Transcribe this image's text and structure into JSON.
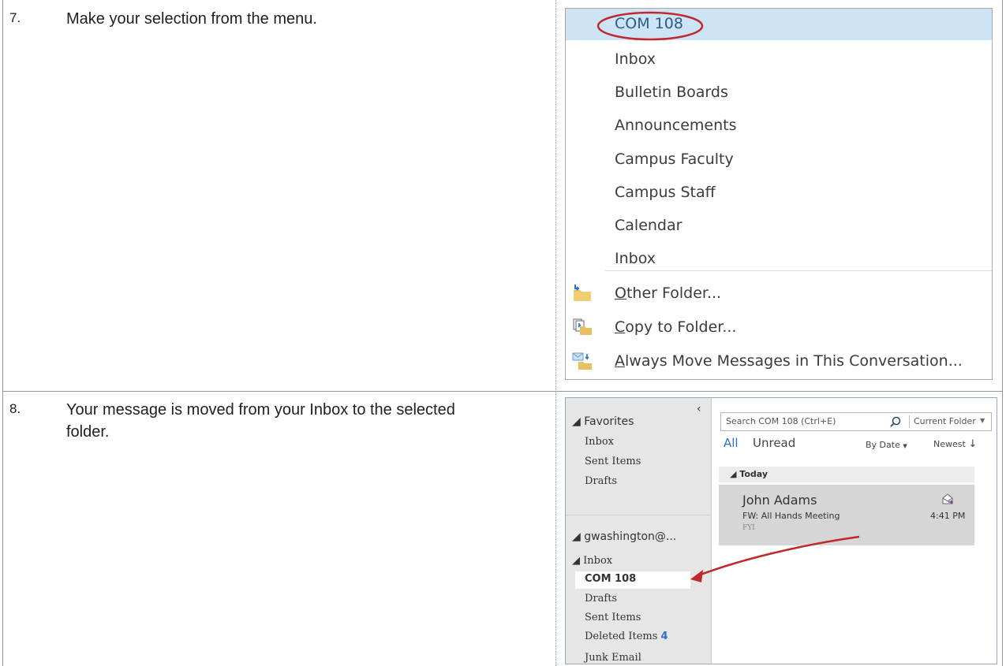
{
  "steps": [
    {
      "number": "7.",
      "text": "Make your selection from the menu."
    },
    {
      "number": "8.",
      "text": "Your message is moved from your Inbox to the selected folder."
    }
  ],
  "menu": {
    "items": [
      {
        "label": "COM 108",
        "selected": true
      },
      {
        "label": "Inbox"
      },
      {
        "label": "Bulletin Boards"
      },
      {
        "label": "Announcements"
      },
      {
        "label": "Campus Faculty"
      },
      {
        "label": "Campus Staff"
      },
      {
        "label": "Calendar"
      },
      {
        "label": "Inbox"
      }
    ],
    "actions": [
      {
        "accel": "O",
        "rest": "ther Folder...",
        "icon": "folder-move-icon"
      },
      {
        "accel": "C",
        "rest": "opy to Folder...",
        "icon": "folder-copy-icon"
      },
      {
        "accel": "A",
        "rest": "lways Move Messages in This Conversation...",
        "icon": "always-move-icon"
      }
    ],
    "highlight_color": "#cce4f5",
    "annotation_color": "#c0282d"
  },
  "outlook": {
    "collapse_glyph": "‹",
    "favorites": {
      "header": "◢ Favorites",
      "items": [
        "Inbox",
        "Sent Items",
        "Drafts"
      ]
    },
    "account": {
      "header": "◢ gwashington@...",
      "inbox": "◢ Inbox",
      "subfolder": "COM 108",
      "items": [
        "Drafts",
        "Sent Items"
      ],
      "deleted_label": "Deleted Items",
      "deleted_count": "4",
      "partial_item": "Junk Email"
    },
    "search": {
      "placeholder": "Search COM 108 (Ctrl+E)",
      "scope": "Current Folder"
    },
    "filters": {
      "all": "All",
      "unread": "Unread",
      "by_date": "By Date",
      "order": "Newest"
    },
    "group_header": "◢ Today",
    "message": {
      "sender": "John Adams",
      "subject": "FW: All Hands Meeting",
      "time": "4:41 PM",
      "preview": "FYI"
    },
    "accent_color": "#2a72c6",
    "arrow_color": "#c0282d"
  }
}
